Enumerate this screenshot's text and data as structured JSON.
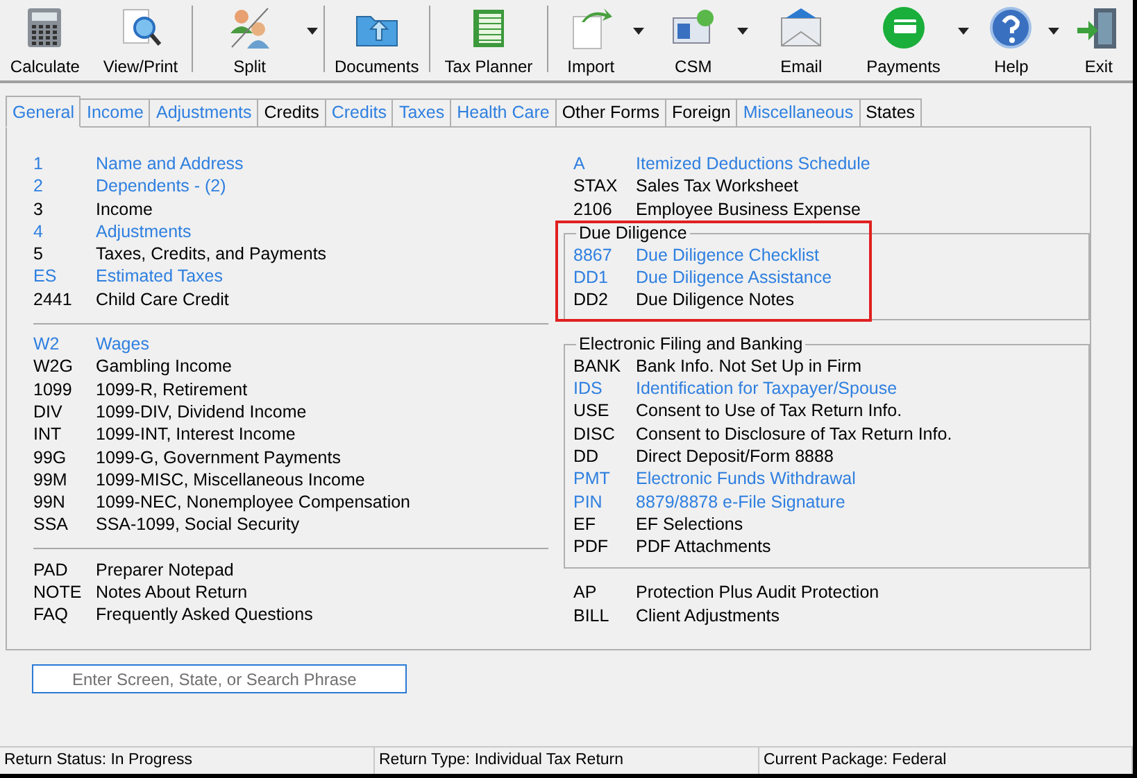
{
  "toolbar": [
    {
      "label": "Calculate",
      "dropdown": false,
      "separator_after": false
    },
    {
      "label": "View/Print",
      "dropdown": false,
      "separator_after": true
    },
    {
      "label": "Split",
      "dropdown": true,
      "separator_after": true
    },
    {
      "label": "Documents",
      "dropdown": false,
      "separator_after": true
    },
    {
      "label": "Tax Planner",
      "dropdown": false,
      "separator_after": true
    },
    {
      "label": "Import",
      "dropdown": true,
      "separator_after": false
    },
    {
      "label": "CSM",
      "dropdown": true,
      "separator_after": false
    },
    {
      "label": "Email",
      "dropdown": false,
      "separator_after": false
    },
    {
      "label": "Payments",
      "dropdown": true,
      "separator_after": false
    },
    {
      "label": "Help",
      "dropdown": true,
      "separator_after": false
    },
    {
      "label": "Exit",
      "dropdown": false,
      "separator_after": false
    }
  ],
  "tabs": [
    {
      "label": "General",
      "selected": true,
      "linked": true
    },
    {
      "label": "Income",
      "selected": false,
      "linked": true
    },
    {
      "label": "Adjustments",
      "selected": false,
      "linked": true
    },
    {
      "label": "Credits",
      "selected": false,
      "linked": false
    },
    {
      "label": "Credits",
      "selected": false,
      "linked": true
    },
    {
      "label": "Taxes",
      "selected": false,
      "linked": true
    },
    {
      "label": "Health Care",
      "selected": false,
      "linked": true
    },
    {
      "label": "Other Forms",
      "selected": false,
      "linked": false
    },
    {
      "label": "Foreign",
      "selected": false,
      "linked": false
    },
    {
      "label": "Miscellaneous",
      "selected": false,
      "linked": true
    },
    {
      "label": "States",
      "selected": false,
      "linked": false
    }
  ],
  "left": [
    {
      "kind": "list",
      "items": [
        {
          "code": "1",
          "title": "Name and Address",
          "linked": true
        },
        {
          "code": "2",
          "title": "Dependents - (2)",
          "linked": true
        },
        {
          "code": "3",
          "title": "Income",
          "linked": false
        },
        {
          "code": "4",
          "title": "Adjustments",
          "linked": true
        },
        {
          "code": "5",
          "title": "Taxes, Credits, and Payments",
          "linked": false
        },
        {
          "code": "ES",
          "title": "Estimated Taxes",
          "linked": true
        },
        {
          "code": "2441",
          "title": "Child Care Credit",
          "linked": false
        }
      ]
    },
    {
      "kind": "list",
      "items": [
        {
          "code": "W2",
          "title": "Wages",
          "linked": true
        },
        {
          "code": "W2G",
          "title": "Gambling Income",
          "linked": false
        },
        {
          "code": "1099",
          "title": "1099-R, Retirement",
          "linked": false
        },
        {
          "code": "DIV",
          "title": "1099-DIV, Dividend Income",
          "linked": false
        },
        {
          "code": "INT",
          "title": "1099-INT, Interest Income",
          "linked": false
        },
        {
          "code": "99G",
          "title": "1099-G, Government Payments",
          "linked": false
        },
        {
          "code": "99M",
          "title": "1099-MISC, Miscellaneous Income",
          "linked": false
        },
        {
          "code": "99N",
          "title": "1099-NEC, Nonemployee Compensation",
          "linked": false
        },
        {
          "code": "SSA",
          "title": "SSA-1099, Social Security",
          "linked": false
        }
      ]
    },
    {
      "kind": "list",
      "items": [
        {
          "code": "PAD",
          "title": "Preparer Notepad",
          "linked": false
        },
        {
          "code": "NOTE",
          "title": "Notes About Return",
          "linked": false
        },
        {
          "code": "FAQ",
          "title": "Frequently Asked Questions",
          "linked": false
        }
      ]
    }
  ],
  "right": [
    {
      "kind": "list",
      "items": [
        {
          "code": "A",
          "title": "Itemized Deductions Schedule",
          "linked": true
        },
        {
          "code": "STAX",
          "title": "Sales Tax Worksheet",
          "linked": false
        },
        {
          "code": "2106",
          "title": "Employee Business Expense",
          "linked": false
        }
      ]
    },
    {
      "kind": "group",
      "legend": "Due Diligence",
      "outlined": true,
      "items": [
        {
          "code": "8867",
          "title": "Due Diligence Checklist",
          "linked": true
        },
        {
          "code": "DD1",
          "title": "Due Diligence Assistance",
          "linked": true
        },
        {
          "code": "DD2",
          "title": "Due Diligence Notes",
          "linked": false
        }
      ]
    },
    {
      "kind": "group",
      "legend": "Electronic Filing and Banking",
      "outlined": false,
      "items": [
        {
          "code": "BANK",
          "title": "Bank Info. Not Set Up in Firm",
          "linked": false
        },
        {
          "code": "IDS",
          "title": "Identification for Taxpayer/Spouse",
          "linked": true
        },
        {
          "code": "USE",
          "title": "Consent to Use of Tax Return Info.",
          "linked": false
        },
        {
          "code": "DISC",
          "title": "Consent to Disclosure of Tax Return Info.",
          "linked": false
        },
        {
          "code": "DD",
          "title": "Direct Deposit/Form 8888",
          "linked": false
        },
        {
          "code": "PMT",
          "title": "Electronic Funds Withdrawal",
          "linked": true
        },
        {
          "code": "PIN",
          "title": "8879/8878 e-File Signature",
          "linked": true
        },
        {
          "code": "EF",
          "title": "EF Selections",
          "linked": false
        },
        {
          "code": "PDF",
          "title": "PDF Attachments",
          "linked": false
        }
      ]
    },
    {
      "kind": "list",
      "items": [
        {
          "code": "AP",
          "title": "Protection Plus Audit Protection",
          "linked": false
        },
        {
          "code": "BILL",
          "title": "Client Adjustments",
          "linked": false
        }
      ]
    }
  ],
  "search": {
    "placeholder": "Enter Screen, State, or Search Phrase"
  },
  "status_bar": [
    "Return Status: In Progress",
    "Return Type: Individual Tax Return",
    "Current Package: Federal"
  ]
}
